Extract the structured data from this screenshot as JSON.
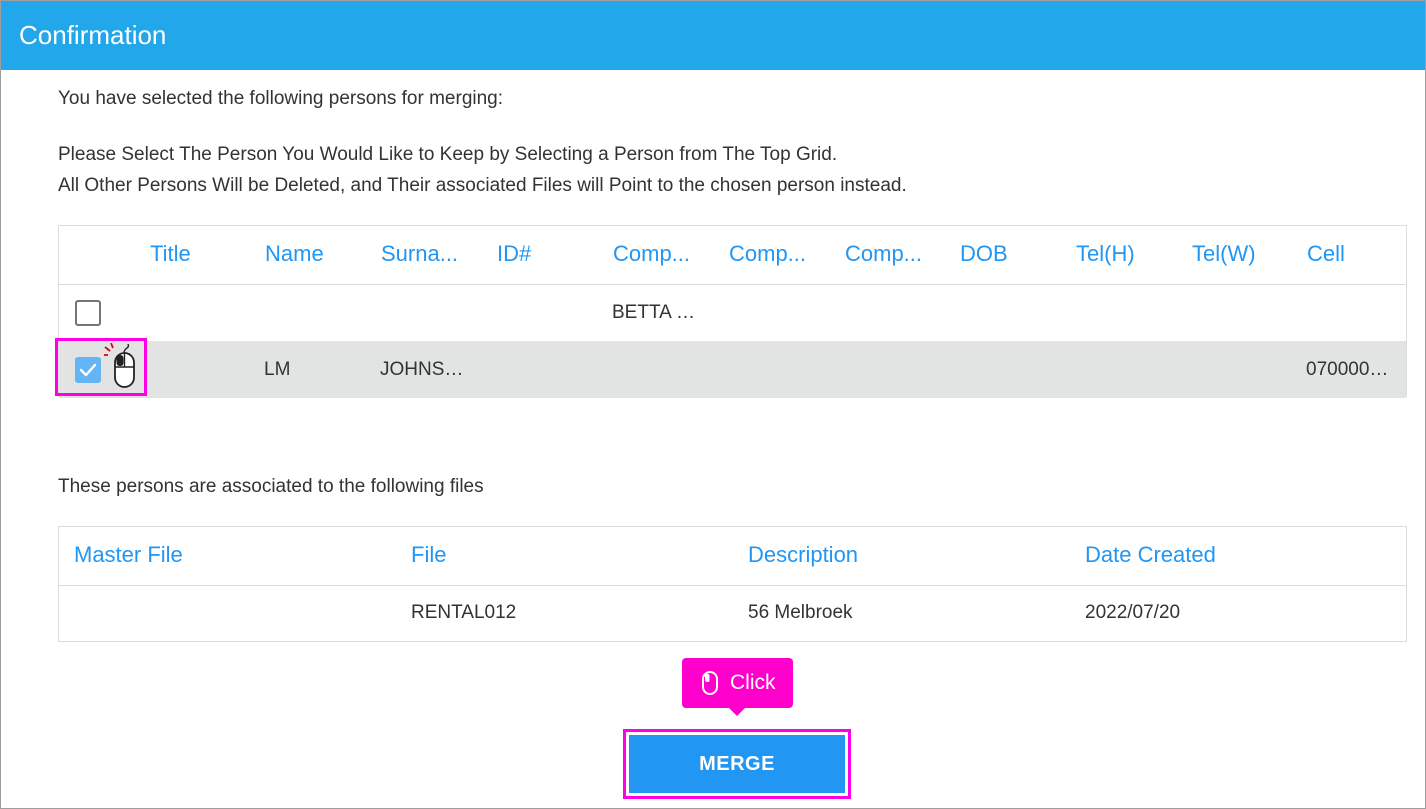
{
  "dialog": {
    "title": "Confirmation"
  },
  "intro": {
    "line1": "You have selected the following persons for merging:",
    "line2": "Please Select The Person You Would Like to Keep by Selecting a Person from The Top Grid.",
    "line3": "All Other Persons Will be Deleted, and Their associated Files will Point to the chosen person instead."
  },
  "persons_grid": {
    "columns": [
      "Title",
      "Name",
      "Surna...",
      "ID#",
      "Comp...",
      "Comp...",
      "Comp...",
      "DOB",
      "Tel(H)",
      "Tel(W)",
      "Cell"
    ],
    "rows": [
      {
        "checked": false,
        "title": "",
        "name": "",
        "surname": "",
        "id": "",
        "comp1": "BETTA …",
        "comp2": "",
        "comp3": "",
        "dob": "",
        "telh": "",
        "telw": "",
        "cell": ""
      },
      {
        "checked": true,
        "title": "",
        "name": "LM",
        "surname": "JOHNS…",
        "id": "",
        "comp1": "",
        "comp2": "",
        "comp3": "",
        "dob": "",
        "telh": "",
        "telw": "",
        "cell": "070000…"
      }
    ]
  },
  "files_section": {
    "label": "These persons are associated to the following files",
    "columns": [
      "Master File",
      "File",
      "Description",
      "Date Created"
    ],
    "rows": [
      {
        "master_file": "",
        "file": "RENTAL012",
        "description": "56 Melbroek",
        "date_created": "2022/07/20"
      }
    ]
  },
  "tooltip": {
    "label": "Click",
    "icon": "mouse-icon"
  },
  "actions": {
    "merge_label": "MERGE"
  },
  "colors": {
    "titlebar": "#22a7ea",
    "accent": "#2196f3",
    "highlight": "#ff00e6",
    "selected_row": "#e1e4e3"
  }
}
